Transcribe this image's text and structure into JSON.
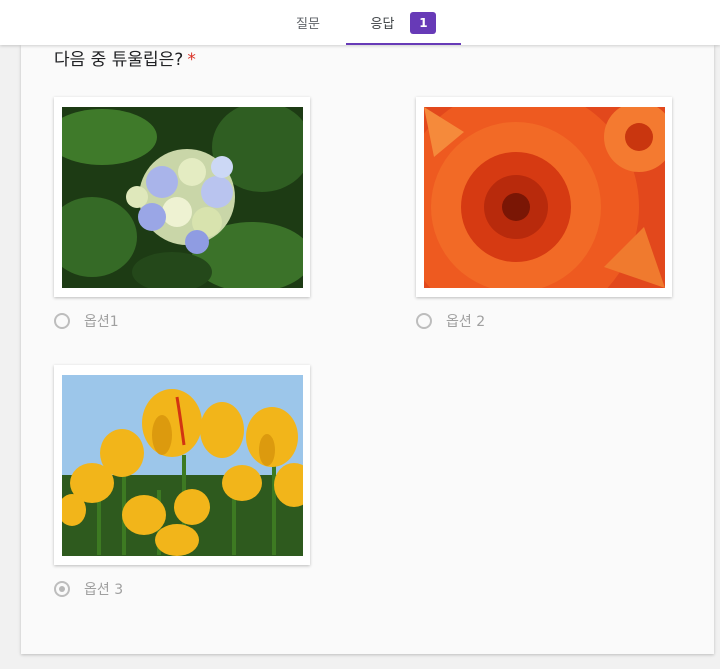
{
  "tabs": {
    "questions_label": "질문",
    "responses_label": "응답",
    "responses_count": "1"
  },
  "question": {
    "title": "다음 중 튜울립은?",
    "required_mark": "*"
  },
  "options": [
    {
      "label": "옵션1",
      "image": "hydrangea-photo",
      "selected": false
    },
    {
      "label": "옵션 2",
      "image": "chrysanthemum-photo",
      "selected": false
    },
    {
      "label": "옵션 3",
      "image": "tulips-photo",
      "selected": true
    }
  ],
  "colors": {
    "accent": "#673ab7",
    "required": "#d93025"
  }
}
